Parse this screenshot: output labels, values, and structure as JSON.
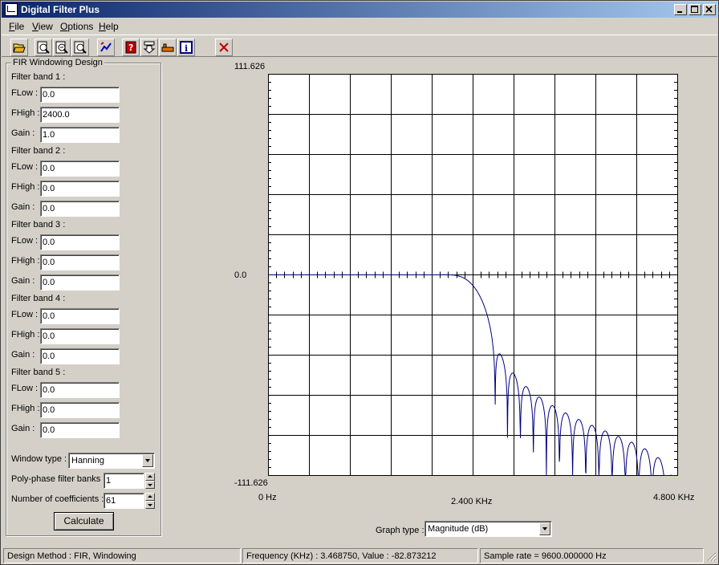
{
  "window": {
    "title": "Digital Filter Plus"
  },
  "menu": [
    {
      "label": "File",
      "accel": "F"
    },
    {
      "label": "View",
      "accel": "V"
    },
    {
      "label": "Options",
      "accel": "O"
    },
    {
      "label": "Help",
      "accel": "H"
    }
  ],
  "toolbar": {
    "buttons": [
      "open-icon",
      "zoom-in-icon",
      "zoom-out-icon",
      "zoom-fit-icon",
      "graph-icon",
      "help-icon",
      "down-arrow-icon",
      "bar-icon",
      "info-icon",
      "close-x-icon"
    ]
  },
  "design": {
    "group_title": "FIR Windowing Design",
    "bands": [
      {
        "title": "Filter band 1 :",
        "flow_label": "FLow :",
        "fhigh_label": "FHigh :",
        "gain_label": "Gain  :",
        "flow": "0.0",
        "fhigh": "2400.0",
        "gain": "1.0"
      },
      {
        "title": "Filter band 2 :",
        "flow_label": "FLow :",
        "fhigh_label": "FHigh :",
        "gain_label": "Gain  :",
        "flow": "0.0",
        "fhigh": "0.0",
        "gain": "0.0"
      },
      {
        "title": "Filter band 3 :",
        "flow_label": "FLow :",
        "fhigh_label": "FHigh :",
        "gain_label": "Gain  :",
        "flow": "0.0",
        "fhigh": "0.0",
        "gain": "0.0"
      },
      {
        "title": "Filter band 4 :",
        "flow_label": "FLow :",
        "fhigh_label": "FHigh :",
        "gain_label": "Gain  :",
        "flow": "0.0",
        "fhigh": "0.0",
        "gain": "0.0"
      },
      {
        "title": "Filter band 5 :",
        "flow_label": "FLow :",
        "fhigh_label": "FHigh :",
        "gain_label": "Gain  :",
        "flow": "0.0",
        "fhigh": "0.0",
        "gain": "0.0"
      }
    ],
    "window_type_label": "Window type :",
    "window_type": "Hanning",
    "polyphase_label": "Poly-phase filter banks :",
    "polyphase": "1",
    "coeff_label": "Number of coefficients :",
    "coeff": "61",
    "calculate_label": "Calculate"
  },
  "graph": {
    "ymax_label": "111.626",
    "ymid_label": "0.0",
    "ymin_label": "-111.626",
    "x_start_label": "0 Hz",
    "x_mid_label": "2.400 KHz",
    "x_end_label": "4.800 KHz",
    "graph_type_label": "Graph type :",
    "graph_type": "Magnitude (dB)",
    "line_color": "#000080",
    "grid_color": "#000000"
  },
  "chart_data": {
    "type": "line",
    "xlabel": "",
    "ylabel": "",
    "xlim": [
      0,
      4800
    ],
    "ylim": [
      -111.626,
      111.626
    ],
    "grid": true,
    "series": [
      {
        "fir_coefficients": 61,
        "window": "Hanning",
        "cutoff_hz": 2400,
        "sample_rate_hz": 9600
      }
    ]
  },
  "status": {
    "method": "Design Method : FIR, Windowing",
    "readout": "Frequency (KHz) : 3.468750, Value : -82.873212",
    "sample_rate": "Sample rate = 9600.000000 Hz"
  }
}
